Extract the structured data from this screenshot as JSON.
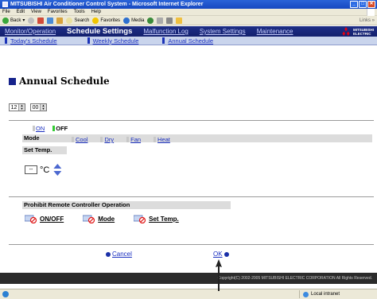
{
  "window": {
    "title": "MITSUBISHI Air Conditioner Control System - Microsoft Internet Explorer",
    "menu": [
      "File",
      "Edit",
      "View",
      "Favorites",
      "Tools",
      "Help"
    ],
    "toolbar": {
      "back": "Back",
      "search": "Search",
      "favorites": "Favorites",
      "media": "Media",
      "links": "Links"
    }
  },
  "nav": {
    "items": [
      {
        "label": "Monitor/Operation",
        "current": false
      },
      {
        "label": "Schedule Settings",
        "current": true
      },
      {
        "label": "Malfunction Log",
        "current": false
      },
      {
        "label": "System Settings",
        "current": false
      },
      {
        "label": "Maintenance",
        "current": false
      }
    ],
    "logo_text_1": "MITSUBISHI",
    "logo_text_2": "ELECTRIC"
  },
  "subnav": {
    "items": [
      "Today's Schedule",
      "Weekly Schedule",
      "Annual Schedule"
    ]
  },
  "page": {
    "title": "Annual Schedule",
    "hour": "12",
    "minute": "00",
    "onoff": {
      "on": "ON",
      "off": "OFF",
      "selected": "OFF"
    },
    "mode": {
      "label": "Mode",
      "options": [
        "Cool",
        "Dry",
        "Fan",
        "Heat"
      ]
    },
    "settemp": {
      "label": "Set Temp.",
      "value": "--",
      "unit": "°C"
    },
    "prohibit": {
      "label": "Prohibit Remote Controller Operation",
      "items": [
        "ON/OFF",
        "Mode",
        "Set Temp."
      ]
    },
    "cancel": "Cancel",
    "ok": "OK"
  },
  "footer": {
    "copyright": "Copyright(C) 2002-2005 MITSUBISHI ELECTRIC CORPORATION All Rights Reserved."
  },
  "status": {
    "zone": "Local intranet"
  },
  "colors": {
    "nav_bg": "#13206d",
    "subnav_bg": "#c9d4ec",
    "link": "#1a2fc0",
    "on_green": "#33cc33",
    "footer_bg": "#2b2b2b"
  }
}
